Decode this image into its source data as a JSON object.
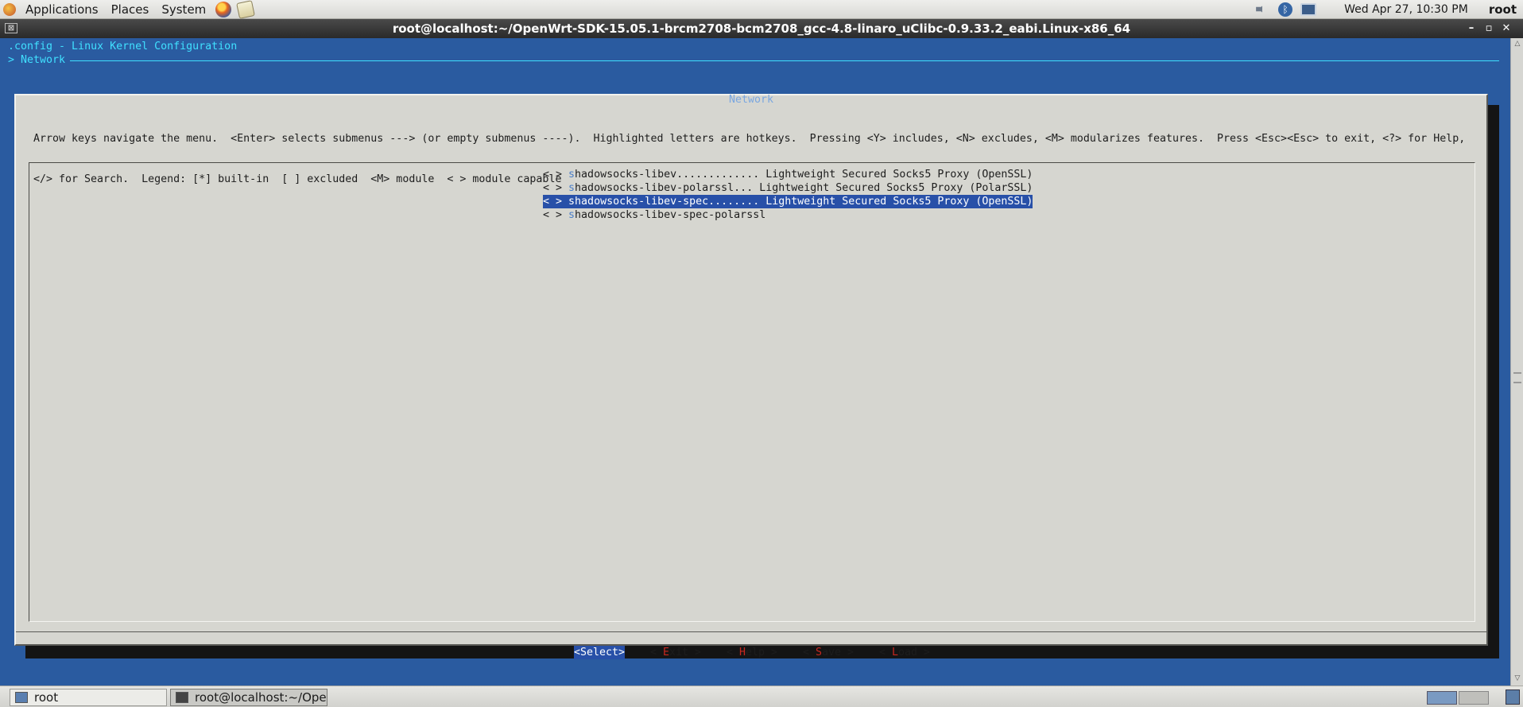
{
  "top_panel": {
    "menus": [
      "Applications",
      "Places",
      "System"
    ],
    "clock": "Wed Apr 27, 10:30 PM",
    "user": "root",
    "bluetooth_glyph": "ᛒ"
  },
  "window": {
    "title": "root@localhost:~/OpenWrt-SDK-15.05.1-brcm2708-bcm2708_gcc-4.8-linaro_uClibc-0.9.33.2_eabi.Linux-x86_64",
    "menu_icon_glyph": "⊠",
    "minimize_glyph": "–",
    "maximize_glyph": "▫",
    "close_glyph": "✕"
  },
  "terminal": {
    "config_title": ".config - Linux Kernel Configuration",
    "breadcrumb": "> Network",
    "dialog_title": "Network",
    "help_lines": [
      "Arrow keys navigate the menu.  <Enter> selects submenus ---> (or empty submenus ----).  Highlighted letters are hotkeys.  Pressing <Y> includes, <N> excludes, <M> modularizes features.  Press <Esc><Esc> to exit, <?> for Help,",
      "</> for Search.  Legend: [*] built-in  [ ] excluded  <M> module  < > module capable"
    ],
    "menu_items": [
      {
        "prefix": "< > ",
        "hotkey": "s",
        "rest": "hadowsocks-libev............. Lightweight Secured Socks5 Proxy (OpenSSL)",
        "selected": false
      },
      {
        "prefix": "< > ",
        "hotkey": "s",
        "rest": "hadowsocks-libev-polarssl... Lightweight Secured Socks5 Proxy (PolarSSL)",
        "selected": false
      },
      {
        "prefix": "< > ",
        "hotkey": "s",
        "rest": "hadowsocks-libev-spec........ Lightweight Secured Socks5 Proxy (OpenSSL)",
        "selected": true
      },
      {
        "prefix": "< > ",
        "hotkey": "s",
        "rest": "hadowsocks-libev-spec-polarssl",
        "selected": false
      }
    ],
    "buttons": {
      "select": "<Select>",
      "exit_pre": "< ",
      "exit_hot": "E",
      "exit_rest": "xit >",
      "help_pre": "< ",
      "help_hot": "H",
      "help_rest": "elp >",
      "save_pre": "< ",
      "save_hot": "S",
      "save_rest": "ave >",
      "load_pre": "< ",
      "load_hot": "L",
      "load_rest": "oad >"
    },
    "scroll_up_glyph": "△",
    "scroll_down_glyph": "▽"
  },
  "taskbar": {
    "tasks": [
      "root",
      "root@localhost:~/Ope..."
    ]
  }
}
